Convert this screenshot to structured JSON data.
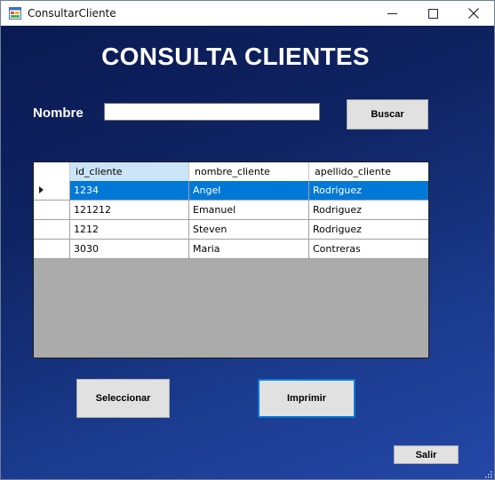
{
  "window": {
    "title": "ConsultarCliente",
    "icon": "winforms-app-icon",
    "controls": [
      "minimize-icon",
      "maximize-icon",
      "close-icon"
    ]
  },
  "form": {
    "heading": "CONSULTA CLIENTES",
    "nombre_label": "Nombre",
    "nombre_value": "",
    "buscar_label": "Buscar",
    "seleccionar_label": "Seleccionar",
    "imprimir_label": "Imprimir",
    "salir_label": "Salir"
  },
  "grid": {
    "columns": [
      "id_cliente",
      "nombre_cliente",
      "apellido_cliente"
    ],
    "selected_row": 0,
    "rows": [
      {
        "id": "1234",
        "nombre": "Angel",
        "apellido": "Rodriguez"
      },
      {
        "id": "121212",
        "nombre": "Emanuel",
        "apellido": "Rodriguez"
      },
      {
        "id": "1212",
        "nombre": "Steven",
        "apellido": "Rodriguez"
      },
      {
        "id": "3030",
        "nombre": "Maria",
        "apellido": "Contreras"
      }
    ]
  },
  "colors": {
    "background_gradient": [
      "#0a1a52",
      "#2448a8"
    ],
    "selection": "#0078d7",
    "header_highlight": "#cce4f7",
    "grid_empty": "#ababab",
    "button_face": "#e1e1e1"
  }
}
